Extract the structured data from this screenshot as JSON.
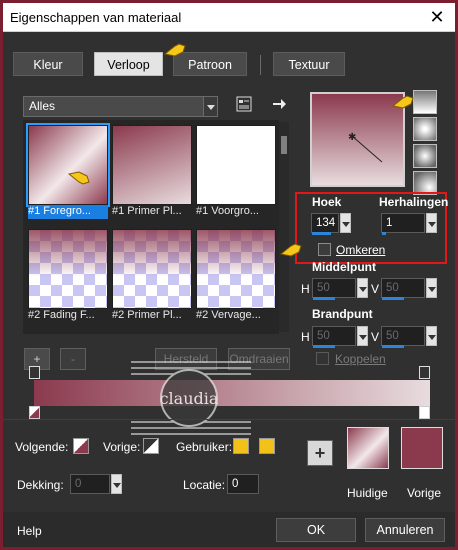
{
  "window": {
    "title": "Eigenschappen van materiaal",
    "close_glyph": "✕"
  },
  "tabs": [
    {
      "label": "Kleur"
    },
    {
      "label": "Verloop"
    },
    {
      "label": "Patroon"
    },
    {
      "label": "Textuur"
    }
  ],
  "category": {
    "selected": "Alles"
  },
  "thumbnails": [
    {
      "caption": "#1 Foregro..."
    },
    {
      "caption": "#1 Primer Pl..."
    },
    {
      "caption": "#1 Voorgro..."
    },
    {
      "caption": "#2 Fading F..."
    },
    {
      "caption": "#2 Primer Pl..."
    },
    {
      "caption": "#2 Vervage..."
    }
  ],
  "angle": {
    "label": "Hoek",
    "value": "134"
  },
  "repeats": {
    "label": "Herhalingen",
    "value": "1"
  },
  "invert": {
    "label": "Omkeren"
  },
  "midpoint": {
    "label": "Middelpunt",
    "h_label": "H",
    "h_value": "50",
    "v_label": "V",
    "v_value": "50"
  },
  "focal": {
    "label": "Brandpunt",
    "h_label": "H",
    "h_value": "50",
    "v_label": "V",
    "v_value": "50"
  },
  "link": {
    "label": "Koppelen"
  },
  "stop_buttons": {
    "add": "+",
    "remove": "-"
  },
  "dim_buttons": {
    "left": "Hersteld",
    "right": "Omdraaien"
  },
  "gradient": {
    "start_color": "#8b3a4e",
    "end_color": "#e8dcde"
  },
  "bottom": {
    "next_label": "Volgende:",
    "prev_label": "Vorige:",
    "user_label": "Gebruiker:",
    "user_color_a": "#f2c21a",
    "user_color_b": "#f2c21a",
    "opacity_label": "Dekking:",
    "opacity_value": "0",
    "location_label": "Locatie:",
    "location_value": "0",
    "add_glyph": "+",
    "current_label": "Huidige",
    "previous_label": "Vorige",
    "previous_color": "#8b3a4e"
  },
  "footer": {
    "help": "Help",
    "ok": "OK",
    "cancel": "Annuleren"
  },
  "watermark_text": "claudia"
}
